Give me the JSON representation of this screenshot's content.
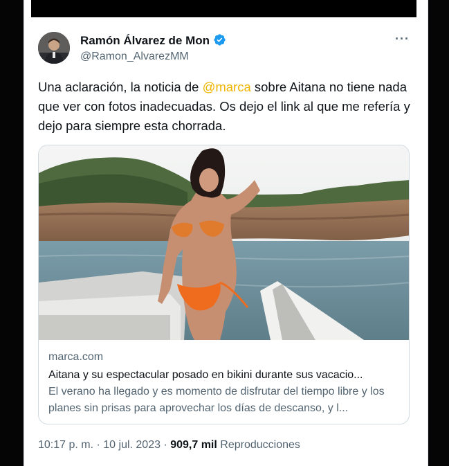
{
  "colors": {
    "mention": "#f0b400",
    "verified": "#1d9bf0",
    "secondary_text": "#536471",
    "primary_text": "#0f1419"
  },
  "author": {
    "display_name": "Ramón Álvarez de Mon",
    "handle": "@Ramon_AlvarezMM",
    "verified_icon": "verified-badge-icon",
    "avatar_icon": "avatar"
  },
  "menu_icon": "more-options-icon",
  "more_label": "···",
  "tweet": {
    "text_before": "Una aclaración, la noticia de ",
    "mention": "@marca",
    "text_after": " sobre Aitana no tiene nada que ver con fotos inadecuadas. Os dejo el link al que me refería y dejo para siempre esta chorrada."
  },
  "link_card": {
    "image_icon": "link-preview-photo",
    "domain": "marca.com",
    "title": "Aitana y su espectacular posado en bikini durante sus vacacio...",
    "description": "El verano ha llegado y es momento de disfrutar del tiempo libre y los planes sin prisas para aprovechar los días de descanso, y l..."
  },
  "meta": {
    "time": "10:17 p. m.",
    "separator": " · ",
    "date": "10 jul. 2023",
    "views_count": "909,7 mil",
    "views_label": "Reproducciones"
  }
}
